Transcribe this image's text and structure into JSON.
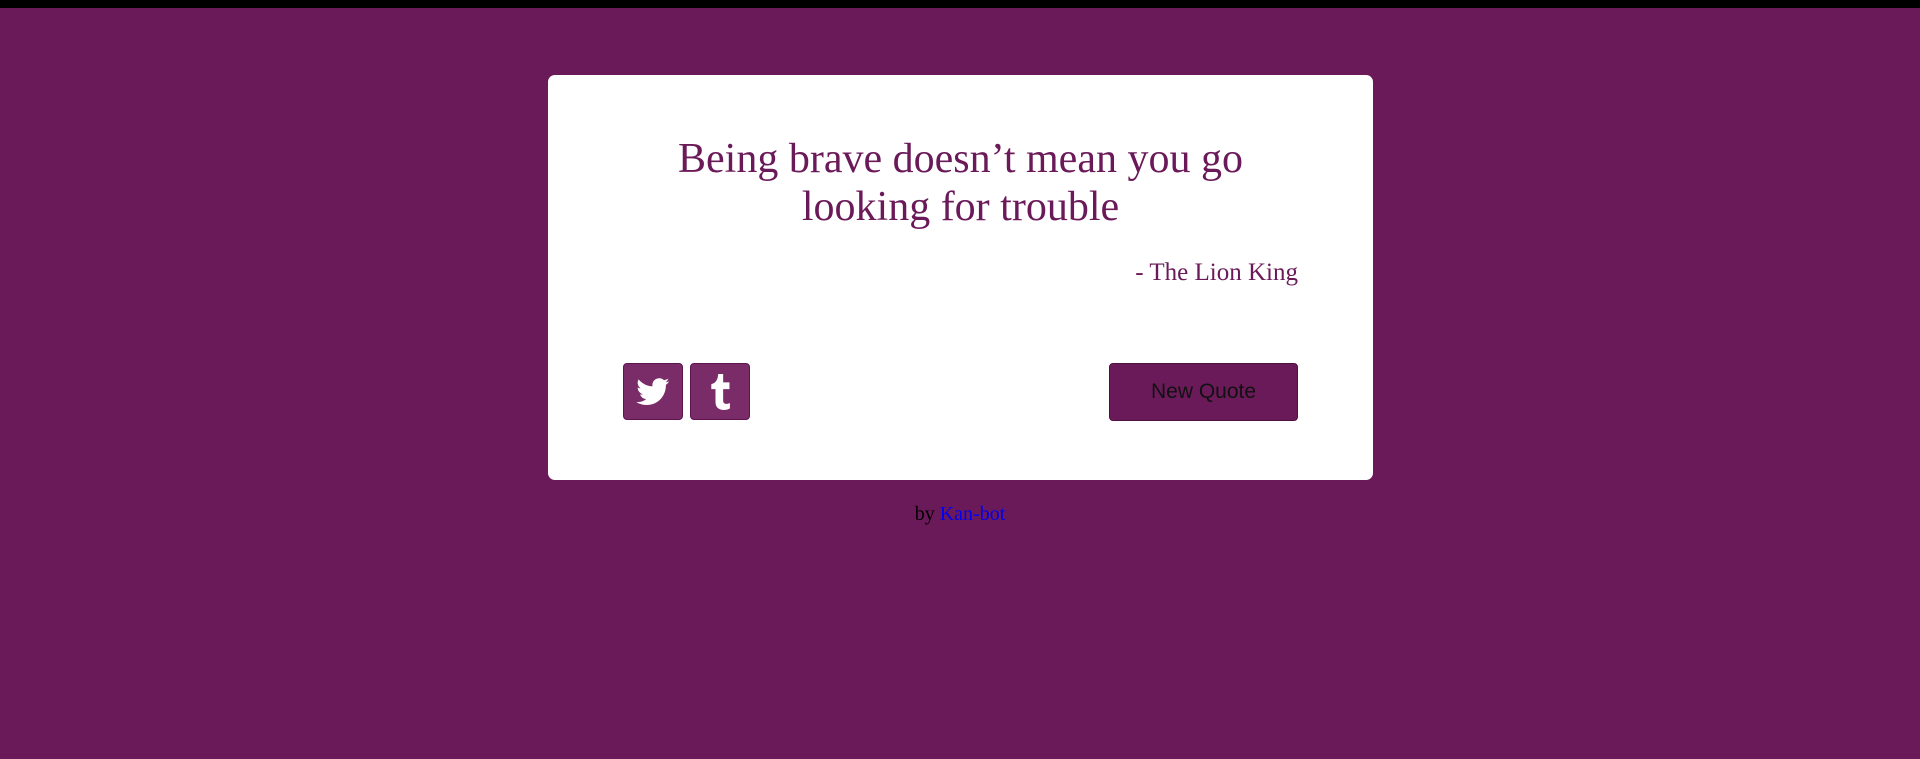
{
  "quote": {
    "text": "Being brave doesn’t mean you go looking for trouble",
    "author": "- The Lion King"
  },
  "share": {
    "twitter_icon": "twitter-icon",
    "tumblr_icon": "tumblr-icon"
  },
  "actions": {
    "new_quote_label": "New Quote"
  },
  "footer": {
    "prefix": "by",
    "author_link": "Kan-bot"
  },
  "colors": {
    "background": "#6b1a59",
    "card": "#ffffff",
    "share_button": "#7a2c69",
    "link": "#0000ee"
  }
}
